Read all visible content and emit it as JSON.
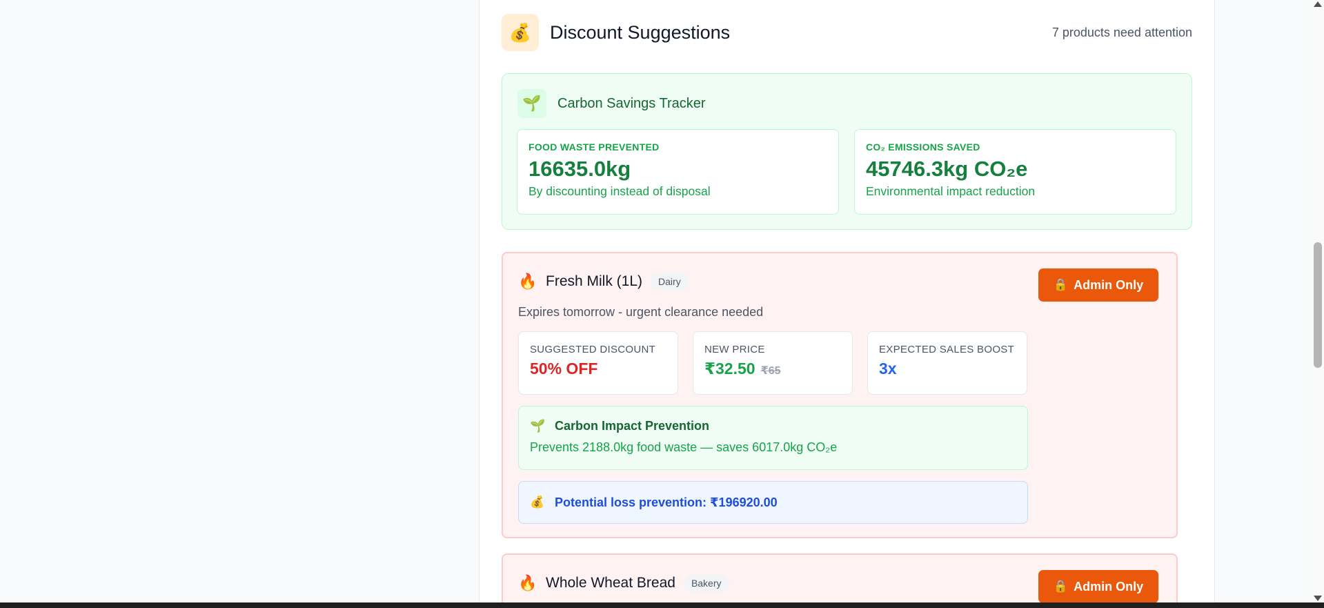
{
  "header": {
    "icon": "money-bag-icon",
    "icon_glyph": "💰",
    "title": "Discount Suggestions",
    "attention_count": "7 products need attention"
  },
  "carbon_tracker": {
    "icon_glyph": "🌱",
    "title": "Carbon Savings Tracker",
    "food_waste": {
      "label": "FOOD WASTE PREVENTED",
      "value": "16635.0kg",
      "note": "By discounting instead of disposal"
    },
    "co2": {
      "label": "CO₂ EMISSIONS SAVED",
      "value": "45746.3kg CO₂e",
      "note": "Environmental impact reduction"
    }
  },
  "products": [
    {
      "icon_glyph": "🔥",
      "name": "Fresh Milk (1L)",
      "category": "Dairy",
      "admin_label": "Admin Only",
      "description": "Expires tomorrow - urgent clearance needed",
      "discount_label": "SUGGESTED DISCOUNT",
      "discount_value": "50% OFF",
      "price_label": "NEW PRICE",
      "new_price": "₹32.50",
      "old_price": "₹65",
      "boost_label": "EXPECTED SALES BOOST",
      "boost_value": "3x",
      "impact_title": "Carbon Impact Prevention",
      "impact_text": "Prevents 2188.0kg food waste — saves 6017.0kg CO₂e",
      "loss_text": "Potential loss prevention: ₹196920.00"
    },
    {
      "icon_glyph": "🔥",
      "name": "Whole Wheat Bread",
      "category": "Bakery",
      "admin_label": "Admin Only"
    }
  ],
  "icons": {
    "lock": "🔒",
    "seedling": "🌱",
    "money_bag": "💰"
  },
  "colors": {
    "accent_orange": "#ea580c",
    "green": "#16a34a",
    "red": "#dc2626",
    "blue": "#2563eb"
  }
}
